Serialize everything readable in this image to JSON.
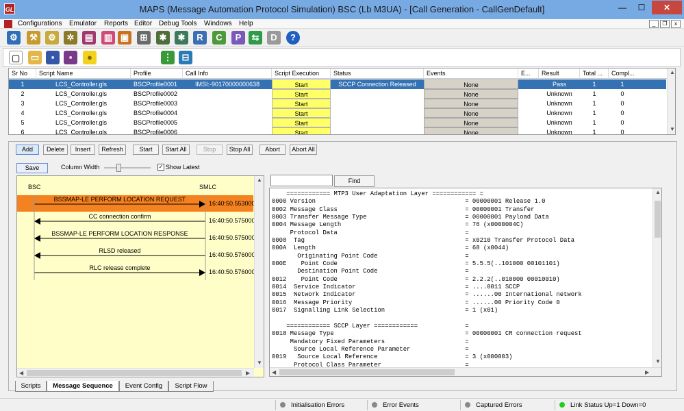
{
  "window": {
    "title": "MAPS (Message Automation Protocol Simulation) BSC (Lb  M3UA) - [Call Generation  - CallGenDefault]",
    "app_icon_text": "GL",
    "min_glyph": "—",
    "max_glyph": "☐",
    "close_glyph": "✕"
  },
  "menu": {
    "items": [
      "Configurations",
      "Emulator",
      "Reports",
      "Editor",
      "Debug Tools",
      "Windows",
      "Help"
    ],
    "mdi_min": "_",
    "mdi_restore": "❐",
    "mdi_close": "x"
  },
  "grid": {
    "headers": [
      "Sr No",
      "Script Name",
      "Profile",
      "Call Info",
      "Script Execution",
      "Status",
      "Events",
      "E...",
      "Result",
      "Total ...",
      "Compl..."
    ],
    "rows": [
      {
        "sr": "1",
        "script": "LCS_Controller.gls",
        "profile": "BSCProfile0001",
        "call_info": "IMSI:-90170000000638",
        "exec": "Start",
        "status": "SCCP Connection Released",
        "events": "None",
        "e": "",
        "result": "Pass",
        "total": "1",
        "complete": "1"
      },
      {
        "sr": "2",
        "script": "LCS_Controller.gls",
        "profile": "BSCProfile0002",
        "call_info": "",
        "exec": "Start",
        "status": "",
        "events": "None",
        "e": "",
        "result": "Unknown",
        "total": "1",
        "complete": "0"
      },
      {
        "sr": "3",
        "script": "LCS_Controller.gls",
        "profile": "BSCProfile0003",
        "call_info": "",
        "exec": "Start",
        "status": "",
        "events": "None",
        "e": "",
        "result": "Unknown",
        "total": "1",
        "complete": "0"
      },
      {
        "sr": "4",
        "script": "LCS_Controller.gls",
        "profile": "BSCProfile0004",
        "call_info": "",
        "exec": "Start",
        "status": "",
        "events": "None",
        "e": "",
        "result": "Unknown",
        "total": "1",
        "complete": "0"
      },
      {
        "sr": "5",
        "script": "LCS_Controller.gls",
        "profile": "BSCProfile0005",
        "call_info": "",
        "exec": "Start",
        "status": "",
        "events": "None",
        "e": "",
        "result": "Unknown",
        "total": "1",
        "complete": "0"
      },
      {
        "sr": "6",
        "script": "LCS_Controller.gls",
        "profile": "BSCProfile0006",
        "call_info": "",
        "exec": "Start",
        "status": "",
        "events": "None",
        "e": "",
        "result": "Unknown",
        "total": "1",
        "complete": "0"
      }
    ]
  },
  "actions": {
    "add": "Add",
    "delete": "Delete",
    "insert": "Insert",
    "refresh": "Refresh",
    "start": "Start",
    "start_all": "Start All",
    "stop": "Stop",
    "stop_all": "Stop All",
    "abort": "Abort",
    "abort_all": "Abort All"
  },
  "seq_controls": {
    "save": "Save",
    "column_width_label": "Column Width",
    "show_latest": "Show Latest",
    "show_latest_checked": true,
    "column_width_level": 0.3
  },
  "sequence": {
    "left_entity": "BSC",
    "right_entity": "SMLC",
    "messages": [
      {
        "text": "BSSMAP-LE PERFORM LOCATION REQUEST",
        "time": "16:40:50.553000",
        "direction": "right",
        "highlighted": true
      },
      {
        "text": "CC connection confirm",
        "time": "16:40:50.575000",
        "direction": "left",
        "highlighted": false
      },
      {
        "text": "BSSMAP-LE PERFORM LOCATION RESPONSE",
        "time": "16:40:50.575000",
        "direction": "left",
        "highlighted": false
      },
      {
        "text": "RLSD released",
        "time": "16:40:50.576000",
        "direction": "left",
        "highlighted": false
      },
      {
        "text": "RLC release complete",
        "time": "16:40:50.576000",
        "direction": "right",
        "highlighted": false
      }
    ],
    "highlight_color": "#f58220"
  },
  "find": {
    "button": "Find",
    "value": ""
  },
  "detail_lines": [
    "    ============ MTP3 User Adaptation Layer ============ =",
    "0000 Version                                         = 00000001 Release 1.0",
    "0002 Message Class                                   = 00000001 Transfer",
    "0003 Transfer Message Type                           = 00000001 Payload Data",
    "0004 Message Length                                  = 76 (x0000004C)",
    "     Protocol Data                                   =",
    "0008  Tag                                            = x0210 Transfer Protocol Data",
    "000A  Length                                         = 68 (x0044)",
    "       Originating Point Code                        =",
    "000E    Point Code                                   = 5.5.5(..101000 00101101)",
    "       Destination Point Code                        =",
    "0012    Point Code                                   = 2.2.2(..010000 00010010)",
    "0014  Service Indicator                              = ....0011 SCCP",
    "0015  Network Indicator                              = ......00 International network",
    "0016  Message Priority                               = ......00 Priority Code 0",
    "0017  Signalling Link Selection                      = 1 (x01)",
    "",
    "    ============ SCCP Layer ============             =",
    "0018 Message Type                                    = 00000001 CR connection request",
    "     Mandatory Fixed Parameters                      =",
    "      Source Local Reference Parameter               =",
    "0019   Source Local Reference                        = 3 (x000003)",
    "      Protocol Class Parameter                       ="
  ],
  "tabs": [
    "Scripts",
    "Message Sequence",
    "Event Config",
    "Script Flow"
  ],
  "active_tab": "Message Sequence",
  "status_bar": {
    "init_errors": "Initialisation Errors",
    "error_events": "Error Events",
    "captured_errors": "Captured Errors",
    "link_status": "Link Status Up=1 Down=0"
  },
  "colors": {
    "titlebar": "#77a9e3",
    "selection": "#3472b4",
    "start_cell": "#ffff66",
    "seq_background": "#fffec9",
    "link_up": "#22cc22",
    "status_idle": "#888888"
  }
}
